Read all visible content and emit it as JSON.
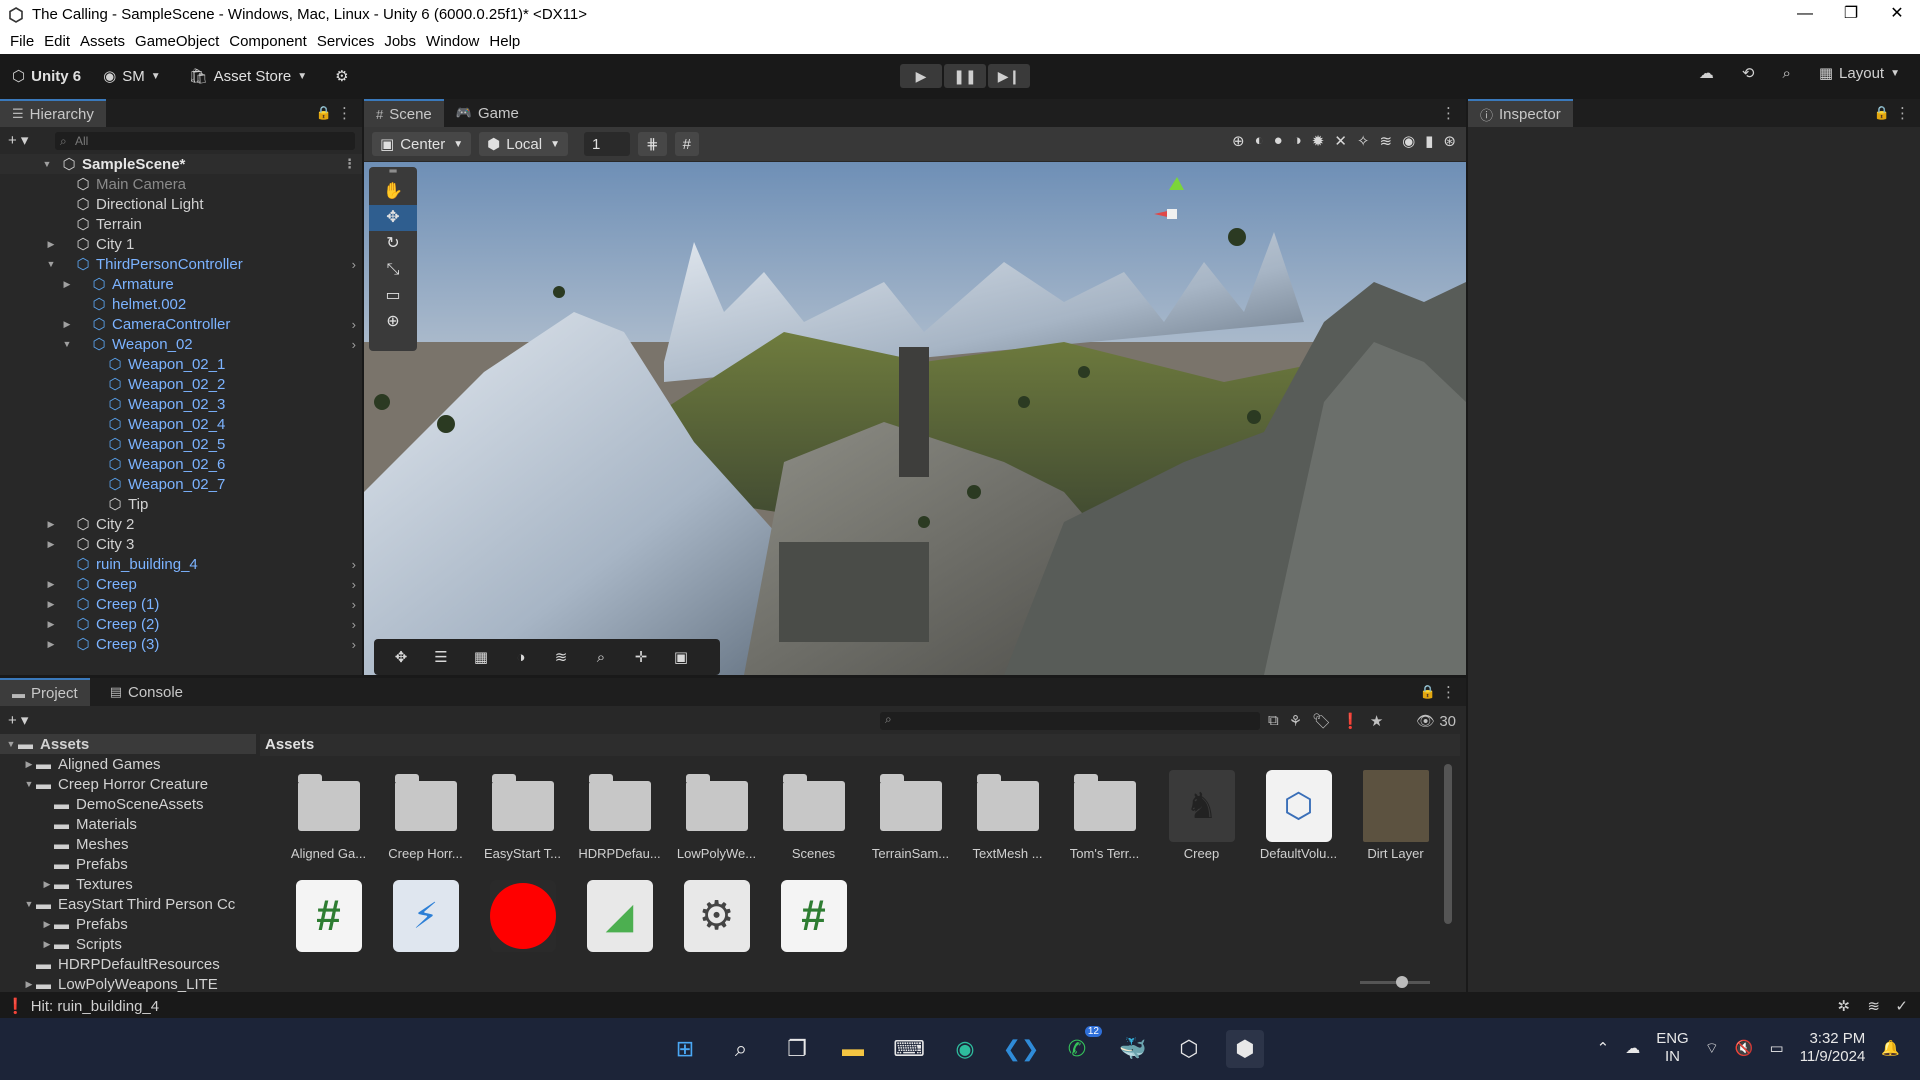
{
  "window": {
    "title": "The Calling - SampleScene - Windows, Mac, Linux - Unity 6 (6000.0.25f1)* <DX11>",
    "controls": [
      "—",
      "❐",
      "✕"
    ]
  },
  "menu": [
    "File",
    "Edit",
    "Assets",
    "GameObject",
    "Component",
    "Services",
    "Jobs",
    "Window",
    "Help"
  ],
  "toolbar": {
    "unity_label": "Unity 6",
    "account_label": "SM",
    "asset_store_label": "Asset Store",
    "layout_label": "Layout"
  },
  "hierarchy": {
    "tab": "Hierarchy",
    "search_placeholder": "All",
    "scene_name": "SampleScene*",
    "items": [
      {
        "label": "Main Camera",
        "depth": 1,
        "expand": "",
        "style": "dim",
        "chevron": ""
      },
      {
        "label": "Directional Light",
        "depth": 1,
        "expand": "",
        "style": "normal",
        "chevron": ""
      },
      {
        "label": "Terrain",
        "depth": 1,
        "expand": "",
        "style": "normal",
        "chevron": ""
      },
      {
        "label": "City 1",
        "depth": 1,
        "expand": "▶",
        "style": "normal",
        "chevron": ""
      },
      {
        "label": "ThirdPersonController",
        "depth": 1,
        "expand": "▼",
        "style": "blue",
        "chevron": "›"
      },
      {
        "label": "Armature",
        "depth": 2,
        "expand": "▶",
        "style": "blue",
        "chevron": ""
      },
      {
        "label": "helmet.002",
        "depth": 2,
        "expand": "",
        "style": "blue",
        "chevron": ""
      },
      {
        "label": "CameraController",
        "depth": 2,
        "expand": "▶",
        "style": "blue",
        "chevron": "›"
      },
      {
        "label": "Weapon_02",
        "depth": 2,
        "expand": "▼",
        "style": "blue",
        "chevron": "›"
      },
      {
        "label": "Weapon_02_1",
        "depth": 3,
        "expand": "",
        "style": "blue",
        "chevron": ""
      },
      {
        "label": "Weapon_02_2",
        "depth": 3,
        "expand": "",
        "style": "blue",
        "chevron": ""
      },
      {
        "label": "Weapon_02_3",
        "depth": 3,
        "expand": "",
        "style": "blue",
        "chevron": ""
      },
      {
        "label": "Weapon_02_4",
        "depth": 3,
        "expand": "",
        "style": "blue",
        "chevron": ""
      },
      {
        "label": "Weapon_02_5",
        "depth": 3,
        "expand": "",
        "style": "blue",
        "chevron": ""
      },
      {
        "label": "Weapon_02_6",
        "depth": 3,
        "expand": "",
        "style": "blue",
        "chevron": ""
      },
      {
        "label": "Weapon_02_7",
        "depth": 3,
        "expand": "",
        "style": "blue",
        "chevron": ""
      },
      {
        "label": "Tip",
        "depth": 3,
        "expand": "",
        "style": "normal",
        "chevron": ""
      },
      {
        "label": "City 2",
        "depth": 1,
        "expand": "▶",
        "style": "normal",
        "chevron": ""
      },
      {
        "label": "City 3",
        "depth": 1,
        "expand": "▶",
        "style": "normal",
        "chevron": ""
      },
      {
        "label": "ruin_building_4",
        "depth": 1,
        "expand": "",
        "style": "blue",
        "chevron": "›"
      },
      {
        "label": "Creep",
        "depth": 1,
        "expand": "▶",
        "style": "blue",
        "chevron": "›"
      },
      {
        "label": "Creep (1)",
        "depth": 1,
        "expand": "▶",
        "style": "blue",
        "chevron": "›"
      },
      {
        "label": "Creep (2)",
        "depth": 1,
        "expand": "▶",
        "style": "blue",
        "chevron": "›"
      },
      {
        "label": "Creep (3)",
        "depth": 1,
        "expand": "▶",
        "style": "blue",
        "chevron": "›"
      }
    ]
  },
  "scene": {
    "tabs": [
      "Scene",
      "Game"
    ],
    "pivot_label": "Center",
    "space_label": "Local",
    "snap_value": "1"
  },
  "inspector": {
    "tab": "Inspector"
  },
  "project": {
    "tabs": [
      "Project",
      "Console"
    ],
    "asset_count": "30",
    "breadcrumb": "Assets",
    "folders": [
      {
        "label": "Assets",
        "depth": 0,
        "expand": "▼"
      },
      {
        "label": "Aligned Games",
        "depth": 1,
        "expand": "▶"
      },
      {
        "label": "Creep Horror Creature",
        "depth": 1,
        "expand": "▼"
      },
      {
        "label": "DemoSceneAssets",
        "depth": 2,
        "expand": ""
      },
      {
        "label": "Materials",
        "depth": 2,
        "expand": ""
      },
      {
        "label": "Meshes",
        "depth": 2,
        "expand": ""
      },
      {
        "label": "Prefabs",
        "depth": 2,
        "expand": ""
      },
      {
        "label": "Textures",
        "depth": 2,
        "expand": "▶"
      },
      {
        "label": "EasyStart Third Person Cc",
        "depth": 1,
        "expand": "▼"
      },
      {
        "label": "Prefabs",
        "depth": 2,
        "expand": "▶"
      },
      {
        "label": "Scripts",
        "depth": 2,
        "expand": "▶"
      },
      {
        "label": "HDRPDefaultResources",
        "depth": 1,
        "expand": ""
      },
      {
        "label": "LowPolyWeapons_LITE",
        "depth": 1,
        "expand": "▶"
      }
    ],
    "assets_row1": [
      {
        "name": "Aligned Ga...",
        "kind": "folder"
      },
      {
        "name": "Creep Horr...",
        "kind": "folder"
      },
      {
        "name": "EasyStart T...",
        "kind": "folder"
      },
      {
        "name": "HDRPDefau...",
        "kind": "folder"
      },
      {
        "name": "LowPolyWe...",
        "kind": "folder"
      },
      {
        "name": "Scenes",
        "kind": "folder"
      },
      {
        "name": "TerrainSam...",
        "kind": "folder"
      },
      {
        "name": "TextMesh ...",
        "kind": "folder"
      },
      {
        "name": "Tom's Terr...",
        "kind": "folder"
      },
      {
        "name": "Creep",
        "kind": "prefab"
      },
      {
        "name": "DefaultVolu...",
        "kind": "volume"
      },
      {
        "name": "Dirt Layer",
        "kind": "layer"
      }
    ],
    "assets_row2": [
      {
        "kind": "script",
        "glyph": "#"
      },
      {
        "kind": "map"
      },
      {
        "kind": "material-red"
      },
      {
        "kind": "terrain"
      },
      {
        "kind": "settings"
      },
      {
        "kind": "script",
        "glyph": "#"
      }
    ]
  },
  "status": {
    "message": "Hit: ruin_building_4"
  },
  "taskbar": {
    "lang": "ENG",
    "region": "IN",
    "time": "3:32 PM",
    "date": "11/9/2024",
    "whatsapp_badge": "12"
  },
  "colors": {
    "accent": "#3a79bb",
    "prefab_blue": "#7cb3ff",
    "panel": "#282828"
  }
}
